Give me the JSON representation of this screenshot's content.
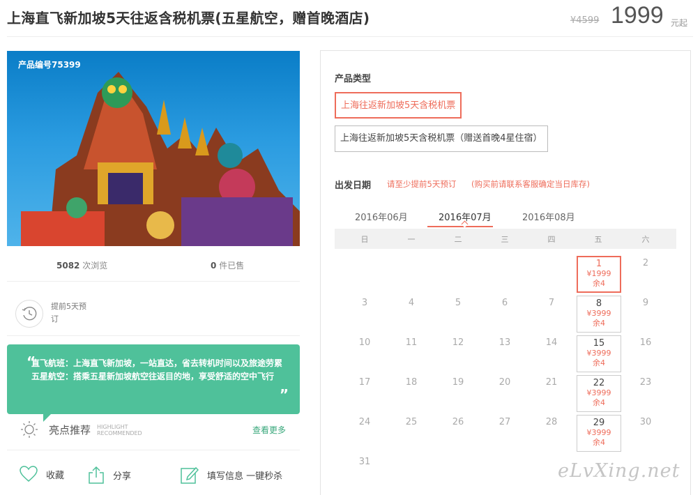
{
  "header": {
    "title": "上海直飞新加坡5天往返含税机票(五星航空，赠首晚酒店)",
    "original_price": "¥4599",
    "price": "1999",
    "price_unit": "元起"
  },
  "product": {
    "code_label": "产品编号75399",
    "views_count": "5082",
    "views_label": "次浏览",
    "sold_count": "0",
    "sold_label": "件已售",
    "advance_notice": "提前5天预订"
  },
  "highlight": {
    "line1": "直飞航班：上海直飞新加坡，一站直达，省去转机时间以及旅途劳累",
    "line2": "五星航空：搭乘五星新加坡航空往返目的地，享受舒适的空中飞行",
    "label": "亮点推荐",
    "label_en_1": "HIGHLIGHT",
    "label_en_2": "RECOMMENDED",
    "see_more": "查看更多"
  },
  "actions": {
    "favorite": "收藏",
    "share": "分享",
    "fill_info": "填写信息 一键秒杀"
  },
  "booking": {
    "product_type_label": "产品类型",
    "options": [
      "上海往返新加坡5天含税机票",
      "上海往返新加坡5天含税机票（赠送首晚4星住宿）"
    ],
    "selected_option": 0,
    "departure_label": "出发日期",
    "note1": "请至少提前5天预订",
    "note2": "(购买前请联系客服确定当日库存)",
    "months": [
      "2016年06月",
      "2016年07月",
      "2016年08月"
    ],
    "active_month": 1,
    "weekdays": [
      "日",
      "一",
      "二",
      "三",
      "四",
      "五",
      "六"
    ],
    "days": [
      "1",
      "2",
      "3",
      "4",
      "5",
      "6",
      "7",
      "8",
      "9",
      "10",
      "11",
      "12",
      "13",
      "14",
      "15",
      "16",
      "17",
      "18",
      "19",
      "20",
      "21",
      "22",
      "23",
      "24",
      "25",
      "26",
      "27",
      "28",
      "29",
      "30",
      "31"
    ],
    "available": [
      {
        "day": "1",
        "price": "¥1999",
        "remaining": "余4",
        "selected": true
      },
      {
        "day": "8",
        "price": "¥3999",
        "remaining": "余4",
        "selected": false
      },
      {
        "day": "15",
        "price": "¥3999",
        "remaining": "余4",
        "selected": false
      },
      {
        "day": "22",
        "price": "¥3999",
        "remaining": "余4",
        "selected": false
      },
      {
        "day": "29",
        "price": "¥3999",
        "remaining": "余4",
        "selected": false
      }
    ]
  },
  "watermark": "eLvXing.net",
  "colors": {
    "accent": "#ee6c5a",
    "green": "#4fc19a",
    "link": "#3aa87c"
  }
}
